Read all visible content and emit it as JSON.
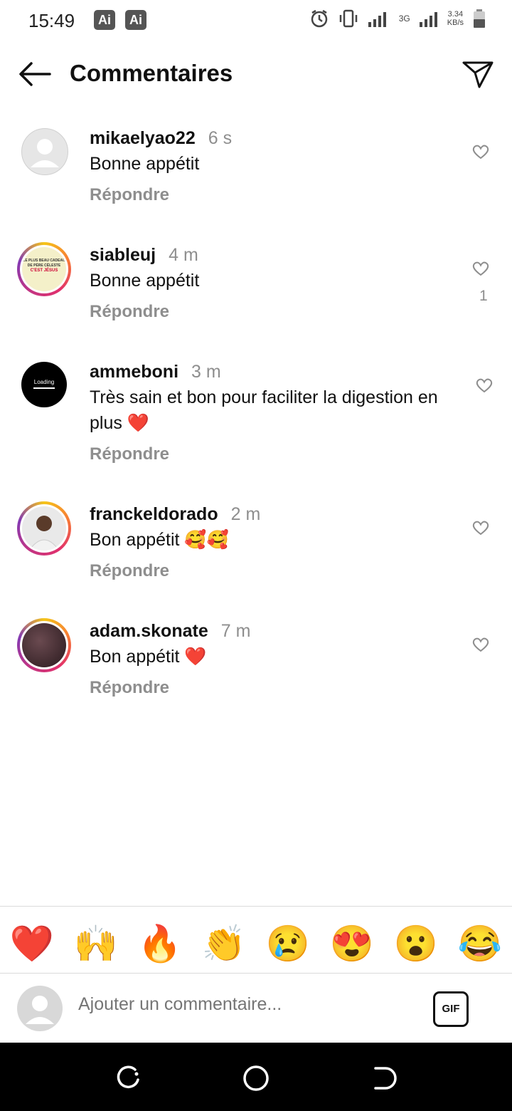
{
  "status_bar": {
    "time": "15:49",
    "badges": [
      "Ai",
      "Ai"
    ],
    "network_type": "3G",
    "speed_value": "3.34",
    "speed_unit": "KB/s"
  },
  "header": {
    "title": "Commentaires",
    "back_icon": "arrow-left-icon",
    "send_icon": "paper-plane-icon"
  },
  "comments": [
    {
      "username": "mikaelyao22",
      "time": "6 s",
      "text": "Bonne appétit",
      "reply_label": "Répondre",
      "likes": ""
    },
    {
      "username": "siableuj",
      "time": "4 m",
      "text": "Bonne appétit",
      "reply_label": "Répondre",
      "likes": "1"
    },
    {
      "username": "ammeboni",
      "time": "3 m",
      "text": "Très sain et bon pour faciliter la digestion en plus ❤️",
      "reply_label": "Répondre",
      "likes": ""
    },
    {
      "username": "franckeldorado",
      "time": "2 m",
      "text": "Bon appétit 🥰🥰",
      "reply_label": "Répondre",
      "likes": ""
    },
    {
      "username": "adam.skonate",
      "time": "7 m",
      "text": "Bon appétit ❤️",
      "reply_label": "Répondre",
      "likes": ""
    }
  ],
  "avatar_text": {
    "siableuj_lines": [
      "LE PLUS BEAU CADEAU",
      "DE PÈRE CÉLESTE",
      "C'EST JÉSUS"
    ],
    "ammeboni_label": "Loading"
  },
  "emoji_bar": [
    "❤️",
    "🙌",
    "🔥",
    "👏",
    "😢",
    "😍",
    "😮",
    "😂"
  ],
  "composer": {
    "placeholder": "Ajouter un commentaire...",
    "gif_label": "GIF"
  },
  "colors": {
    "accent_gray": "#8e8e8e",
    "story_ring_start": "#f5c518",
    "story_ring_end": "#c13584"
  }
}
